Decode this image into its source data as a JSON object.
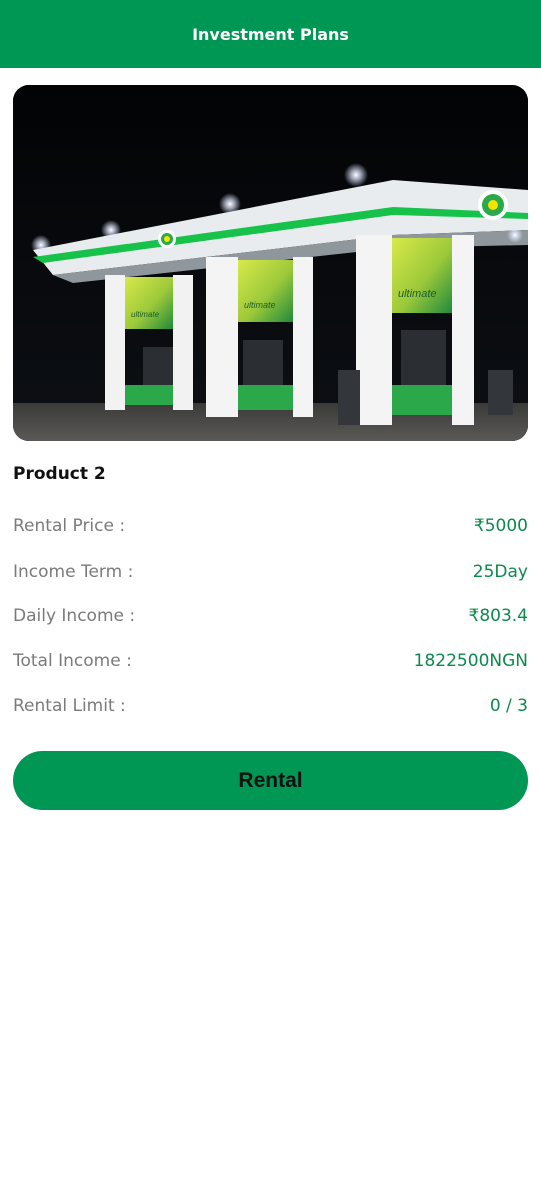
{
  "header": {
    "title": "Investment Plans"
  },
  "hero": {
    "image": "gas-station-photo",
    "brand_text": "ultimate"
  },
  "product": {
    "name": "Product 2",
    "details": [
      {
        "label": "Rental Price :",
        "value": "₹5000"
      },
      {
        "label": "Income Term :",
        "value": "25Day"
      },
      {
        "label": "Daily Income :",
        "value": "₹803.4"
      },
      {
        "label": "Total Income :",
        "value": "1822500NGN"
      },
      {
        "label": "Rental Limit :",
        "value": "0 / 3"
      }
    ]
  },
  "action": {
    "rental_label": "Rental"
  },
  "colors": {
    "brand_green": "#009653",
    "value_green": "#0b8a4c",
    "label_gray": "#7a7a7a"
  }
}
